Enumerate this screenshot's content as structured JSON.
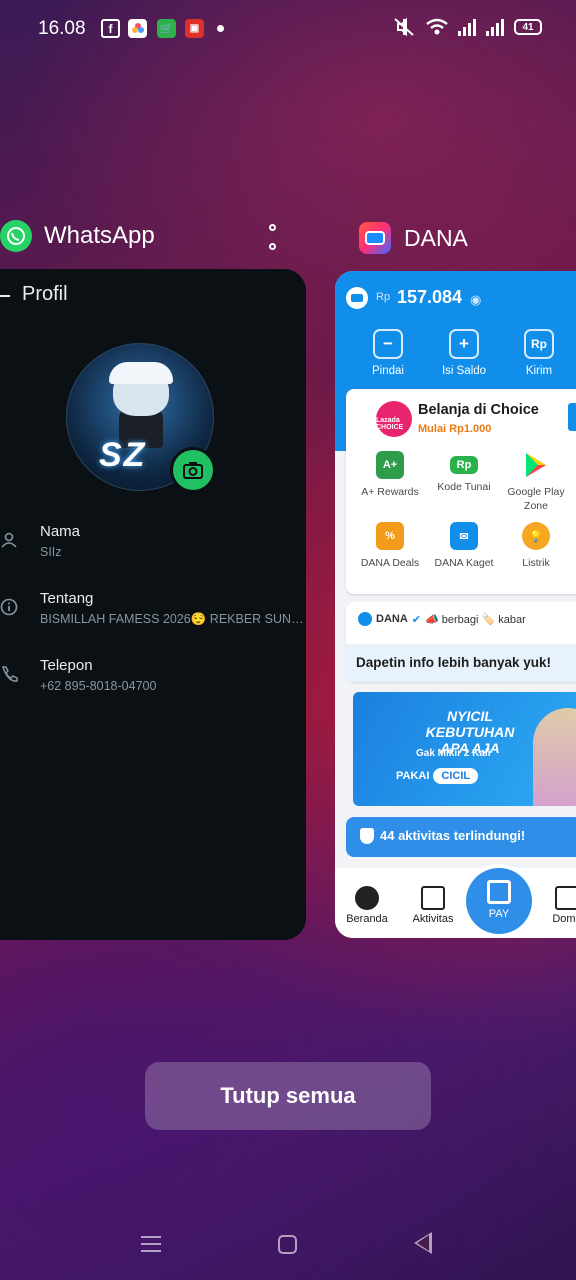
{
  "status_bar": {
    "time": "16.08",
    "battery": "41",
    "icons": [
      "facebook-icon",
      "photos-icon",
      "shop-icon",
      "screen-record-icon",
      "dot-icon",
      "mute-icon",
      "wifi-icon",
      "signal-icon",
      "battery-icon"
    ]
  },
  "whatsapp": {
    "app_name": "WhatsApp",
    "screen_title": "Profil",
    "avatar_text": "SZ",
    "fields": [
      {
        "label": "Nama",
        "value": "SIIz"
      },
      {
        "label": "Tentang",
        "value": "BISMILLAH FAMESS 2026😌 REKBER SUNG..."
      },
      {
        "label": "Telepon",
        "value": "+62 895-8018-04700"
      }
    ]
  },
  "dana": {
    "app_name": "DANA",
    "currency": "Rp",
    "balance": "157.084",
    "actions": [
      "Pindai",
      "Isi Saldo",
      "Kirim"
    ],
    "promo": {
      "logo_text": "Lazada CHOICE",
      "title": "Belanja di Choice",
      "subtitle": "Mulai Rp1.000"
    },
    "services": [
      {
        "label": "A+ Rewards",
        "icon": "rewards-icon"
      },
      {
        "label": "Kode Tunai",
        "icon": "cash-code-icon"
      },
      {
        "label": "Google Play Zone",
        "icon": "google-play-icon"
      },
      {
        "label": "DANA Deals",
        "icon": "deals-icon"
      },
      {
        "label": "DANA Kaget",
        "icon": "kaget-icon"
      },
      {
        "label": "Listrik",
        "icon": "electricity-icon"
      }
    ],
    "feed": {
      "source": "DANA",
      "tags": "📣 berbagi 🏷️ kabar",
      "cta": "Dapetin info lebih banyak yuk!"
    },
    "banner": {
      "headline": "NYICIL KEBUTUHAN APA AJA",
      "tagline": "Gak Mikir 2 Kali",
      "pay_label": "PAKAI",
      "cicil_label": "CICIL"
    },
    "safety": "44 aktivitas terlindungi!",
    "nav": [
      "Beranda",
      "Aktivitas",
      "PAY",
      "Domp"
    ]
  },
  "close_all_label": "Tutup semua"
}
